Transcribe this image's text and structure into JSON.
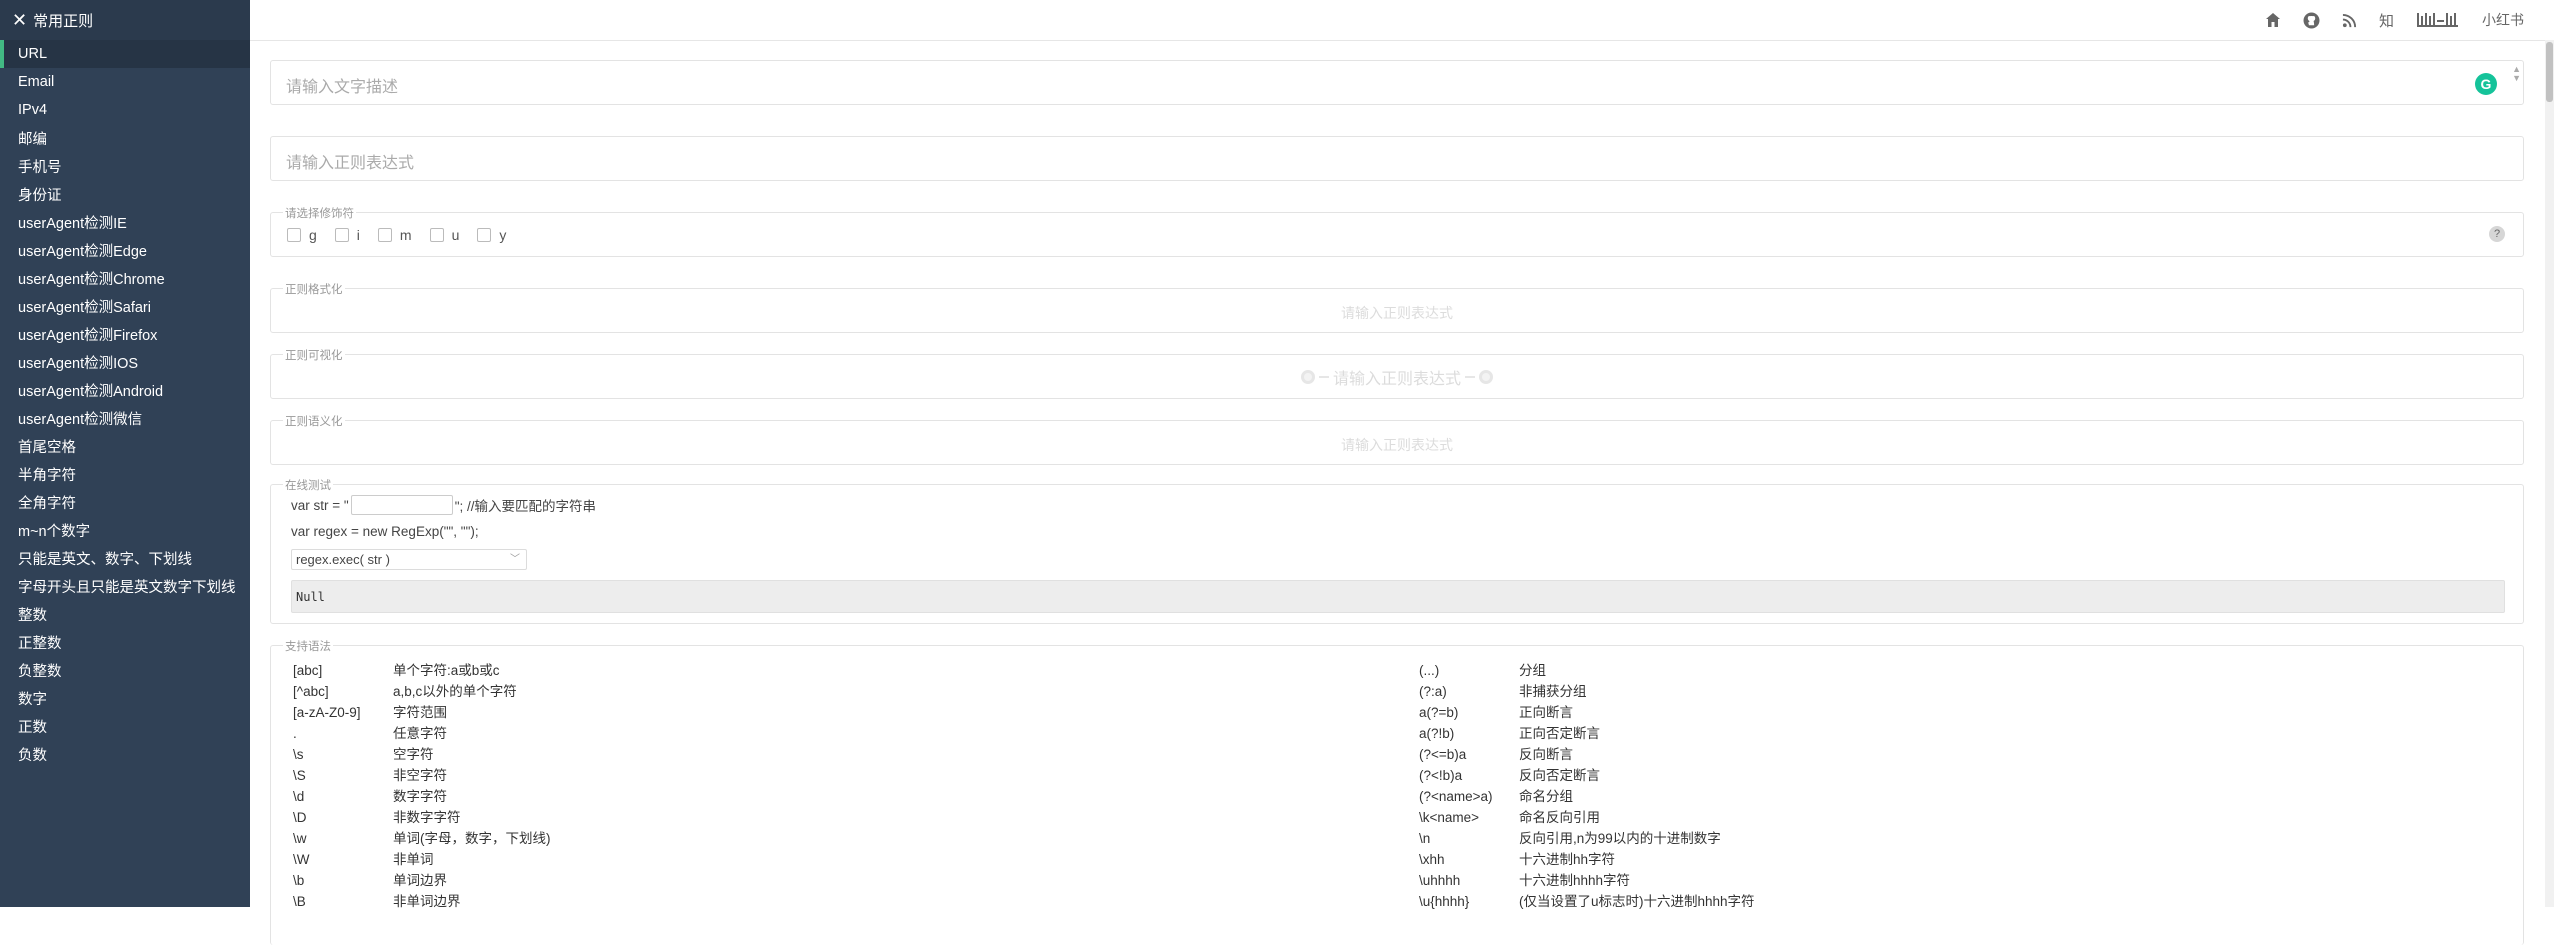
{
  "sidebar": {
    "title": "常用正则",
    "items": [
      {
        "label": "URL",
        "active": true
      },
      {
        "label": "Email"
      },
      {
        "label": "IPv4"
      },
      {
        "label": "邮编"
      },
      {
        "label": "手机号"
      },
      {
        "label": "身份证"
      },
      {
        "label": "userAgent检测IE"
      },
      {
        "label": "userAgent检测Edge"
      },
      {
        "label": "userAgent检测Chrome"
      },
      {
        "label": "userAgent检测Safari"
      },
      {
        "label": "userAgent检测Firefox"
      },
      {
        "label": "userAgent检测IOS"
      },
      {
        "label": "userAgent检测Android"
      },
      {
        "label": "userAgent检测微信"
      },
      {
        "label": "首尾空格"
      },
      {
        "label": "半角字符"
      },
      {
        "label": "全角字符"
      },
      {
        "label": "m~n个数字"
      },
      {
        "label": "只能是英文、数字、下划线"
      },
      {
        "label": "字母开头且只能是英文数字下划线"
      },
      {
        "label": "整数"
      },
      {
        "label": "正整数"
      },
      {
        "label": "负整数"
      },
      {
        "label": "数字"
      },
      {
        "label": "正数"
      },
      {
        "label": "负数"
      }
    ]
  },
  "topbar": {
    "icons": [
      "home-icon",
      "github-icon",
      "rss-icon",
      "zhihu-icon",
      "bilibili-icon",
      "xiaohongshu-icon"
    ],
    "zhihu_label": "知",
    "bilibili_label": "bilibili",
    "xiaohongshu_label": "小红书"
  },
  "main": {
    "desc_placeholder": "请输入文字描述",
    "regex_placeholder": "请输入正则表达式",
    "modifiers": {
      "legend": "请选择修饰符",
      "flags": [
        "g",
        "i",
        "m",
        "u",
        "y"
      ],
      "help": "?"
    },
    "format": {
      "legend": "正则格式化",
      "placeholder": "请输入正则表达式"
    },
    "visual": {
      "legend": "正则可视化",
      "placeholder": "请输入正则表达式"
    },
    "semantic": {
      "legend": "正则语义化",
      "placeholder": "请输入正则表达式"
    },
    "test": {
      "legend": "在线测试",
      "line1_prefix": "var str = \"",
      "line1_suffix": "\"; //输入要匹配的字符串",
      "line2": "var regex = new RegExp(\"\", \"\");",
      "method": "regex.exec( str )",
      "result": "Null"
    },
    "syntax": {
      "legend": "支持语法",
      "left": [
        [
          "[abc]",
          "单个字符:a或b或c"
        ],
        [
          "[^abc]",
          "a,b,c以外的单个字符"
        ],
        [
          "[a-zA-Z0-9]",
          "字符范围"
        ],
        [
          ".",
          "任意字符"
        ],
        [
          "\\s",
          "空字符"
        ],
        [
          "\\S",
          "非空字符"
        ],
        [
          "\\d",
          "数字字符"
        ],
        [
          "\\D",
          "非数字字符"
        ],
        [
          "\\w",
          "单词(字母，数字，下划线)"
        ],
        [
          "\\W",
          "非单词"
        ],
        [
          "\\b",
          "单词边界"
        ],
        [
          "\\B",
          "非单词边界"
        ]
      ],
      "right": [
        [
          "(...)",
          "分组"
        ],
        [
          "(?:a)",
          "非捕获分组"
        ],
        [
          "a(?=b)",
          "正向断言"
        ],
        [
          "a(?!b)",
          "正向否定断言"
        ],
        [
          "(?<=b)a",
          "反向断言"
        ],
        [
          "(?<!b)a",
          "反向否定断言"
        ],
        [
          "(?<name>a)",
          "命名分组"
        ],
        [
          "\\k<name>",
          "命名反向引用"
        ],
        [
          "\\n",
          "反向引用,n为99以内的十进制数字"
        ],
        [
          "\\xhh",
          "十六进制hh字符"
        ],
        [
          "\\uhhhh",
          "十六进制hhhh字符"
        ],
        [
          "\\u{hhhh}",
          "(仅当设置了u标志时)十六进制hhhh字符"
        ]
      ]
    }
  }
}
